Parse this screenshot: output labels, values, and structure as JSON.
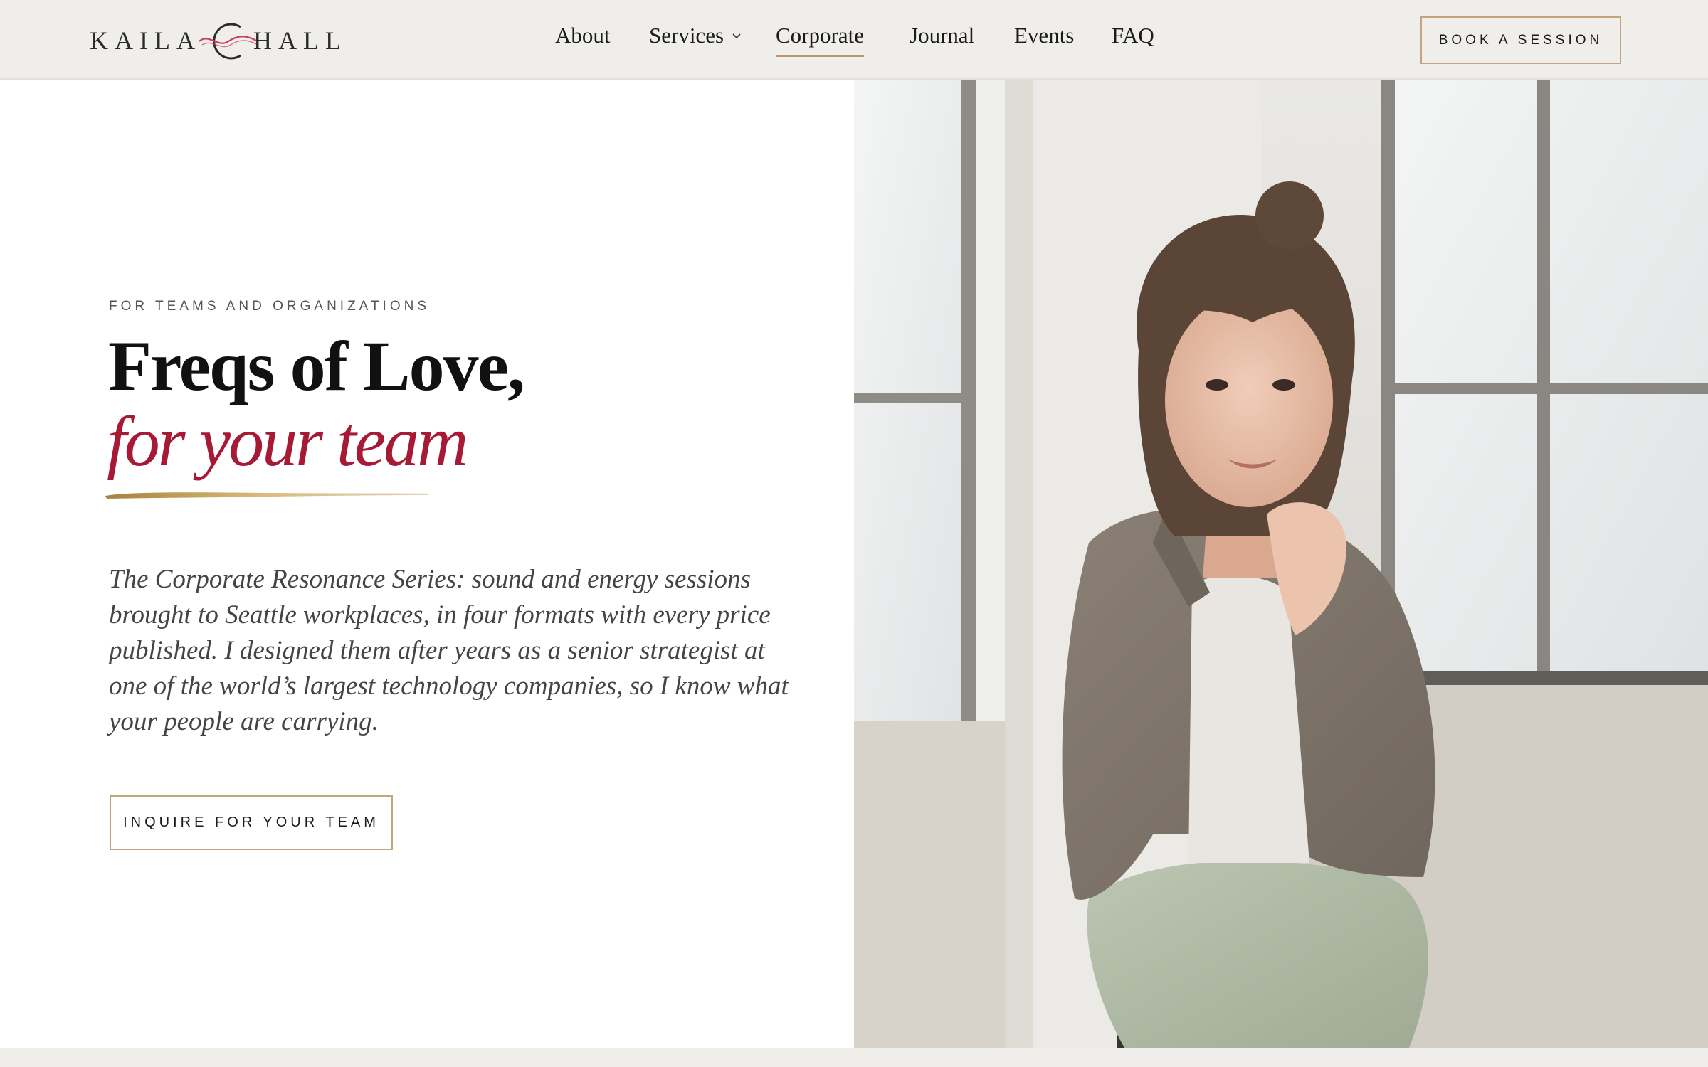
{
  "brand": {
    "name_left": "KAILA",
    "name_right": "HALL",
    "accent_color": "#a71a36",
    "gold_color": "#c2a57a"
  },
  "nav": {
    "items": [
      {
        "label": "About"
      },
      {
        "label": "Services"
      },
      {
        "label": "Corporate"
      },
      {
        "label": "Journal"
      },
      {
        "label": "Events"
      },
      {
        "label": "FAQ"
      }
    ],
    "active": "Corporate",
    "cta_label": "BOOK A SESSION"
  },
  "hero": {
    "eyebrow": "FOR TEAMS AND ORGANIZATIONS",
    "headline": "Freqs of Love,",
    "headline_italic": "for your team",
    "lede": "The Corporate Resonance Series: sound and energy sessions brought to Seattle workplaces, in four formats with every price published. I designed them after years as a senior strategist at one of the world’s largest technology companies, so I know what your people are carrying.",
    "cta_label": "INQUIRE FOR YOUR TEAM"
  },
  "icons": {
    "logo_mark": "wave-circle-logo-icon",
    "services_dropdown": "chevron-down-icon"
  }
}
